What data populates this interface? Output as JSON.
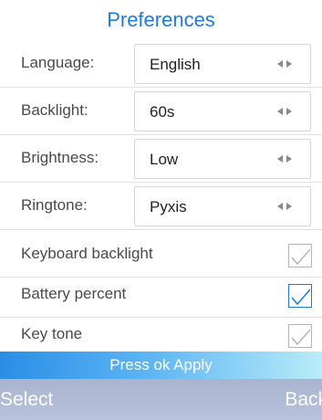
{
  "header": {
    "title": "Preferences"
  },
  "settings": [
    {
      "label": "Language:",
      "value": "English"
    },
    {
      "label": "Backlight:",
      "value": "60s"
    },
    {
      "label": "Brightness:",
      "value": "Low"
    },
    {
      "label": "Ringtone:",
      "value": "Pyxis"
    }
  ],
  "toggles": [
    {
      "label": "Keyboard backlight",
      "checked": true
    },
    {
      "label": "Battery percent",
      "checked": true
    },
    {
      "label": "Key tone",
      "checked": true
    }
  ],
  "hint": {
    "text": "Press ok Apply"
  },
  "softkeys": {
    "left": "Select",
    "right": "Back"
  },
  "colors": {
    "accent": "#1f7bd8",
    "hint_bar_start": "#2a8ee6",
    "hint_bar_end": "#b9ecf9",
    "softkey_bar": "#b1bcd6"
  },
  "icons": {
    "selector": "left-right-arrows-icon",
    "check": "checkmark-icon"
  }
}
